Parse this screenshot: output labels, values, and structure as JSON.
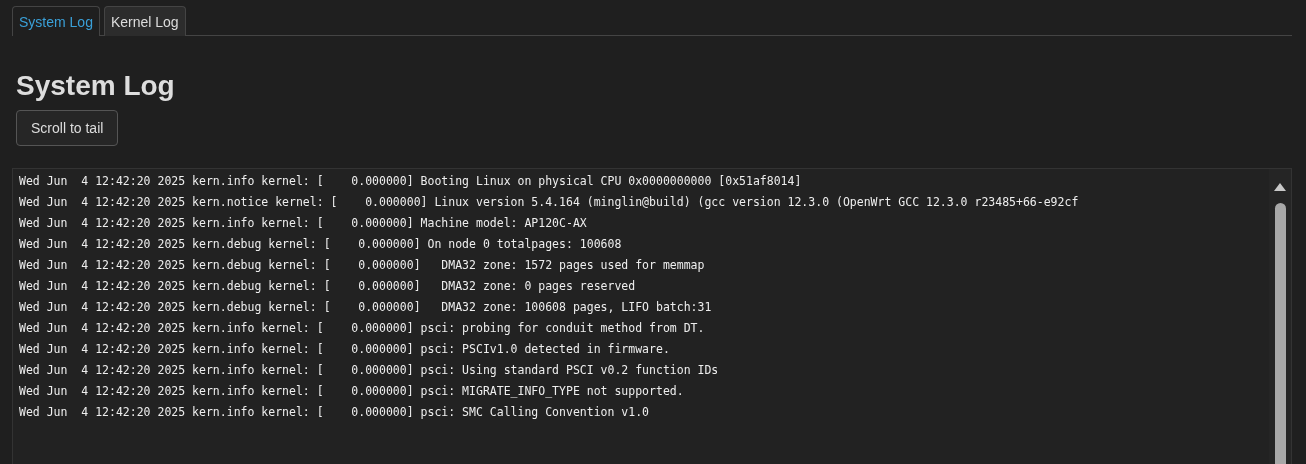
{
  "tabs": [
    {
      "label": "System Log",
      "selected": true
    },
    {
      "label": "Kernel Log",
      "selected": false
    }
  ],
  "heading": "System Log",
  "scroll_button": "Scroll to tail",
  "log": {
    "lines": [
      "Wed Jun  4 12:42:20 2025 kern.info kernel: [    0.000000] Booting Linux on physical CPU 0x0000000000 [0x51af8014]",
      "Wed Jun  4 12:42:20 2025 kern.notice kernel: [    0.000000] Linux version 5.4.164 (minglin@build) (gcc version 12.3.0 (OpenWrt GCC 12.3.0 r23485+66-e92cf",
      "Wed Jun  4 12:42:20 2025 kern.info kernel: [    0.000000] Machine model: AP120C-AX",
      "Wed Jun  4 12:42:20 2025 kern.debug kernel: [    0.000000] On node 0 totalpages: 100608",
      "Wed Jun  4 12:42:20 2025 kern.debug kernel: [    0.000000]   DMA32 zone: 1572 pages used for memmap",
      "Wed Jun  4 12:42:20 2025 kern.debug kernel: [    0.000000]   DMA32 zone: 0 pages reserved",
      "Wed Jun  4 12:42:20 2025 kern.debug kernel: [    0.000000]   DMA32 zone: 100608 pages, LIFO batch:31",
      "Wed Jun  4 12:42:20 2025 kern.info kernel: [    0.000000] psci: probing for conduit method from DT.",
      "Wed Jun  4 12:42:20 2025 kern.info kernel: [    0.000000] psci: PSCIv1.0 detected in firmware.",
      "Wed Jun  4 12:42:20 2025 kern.info kernel: [    0.000000] psci: Using standard PSCI v0.2 function IDs",
      "Wed Jun  4 12:42:20 2025 kern.info kernel: [    0.000000] psci: MIGRATE_INFO_TYPE not supported.",
      "Wed Jun  4 12:42:20 2025 kern.info kernel: [    0.000000] psci: SMC Calling Convention v1.0"
    ]
  }
}
